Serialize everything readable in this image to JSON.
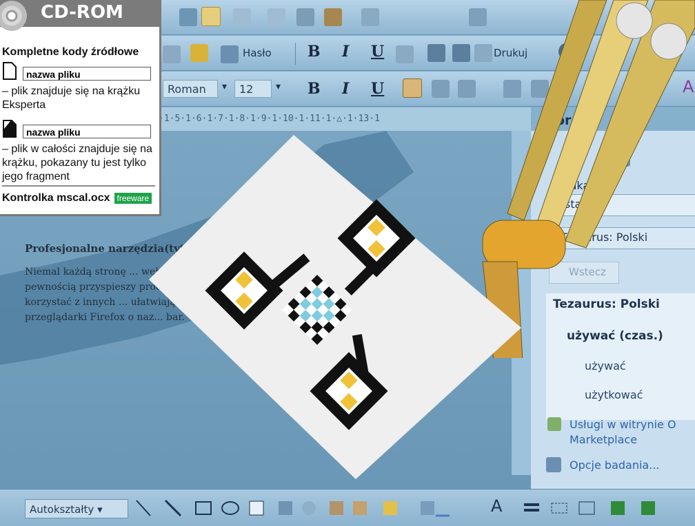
{
  "toolbar_row2": {
    "haslo_label": "Hasło",
    "bold": "B",
    "italic": "I",
    "underline": "U",
    "print_label": "Drukuj"
  },
  "toolbar_row3": {
    "font_name": "Roman",
    "font_size": "12",
    "bold": "B",
    "italic": "I",
    "underline": "U",
    "font_color_letter": "A"
  },
  "ruler": {
    "text": "·1·5·1·6·1·7·1·8·1·9·1·10·1·11·1·△·1·13·1"
  },
  "document": {
    "title": "Profesjonalne narzędzia(tyt... Xxx(lead)",
    "body": "Niemal każdą stronę ... webmaster nie powinien ... narzędzi. Skorzystanie z ba... pewnością przyspieszy proce... pozwoli na zmniejszenie liczby b... tworzenia strony korzystać z innych ... ułatwiających tworzenie strony WWW ... jest dodatek do przeglądarki Firefox o naz... bar."
  },
  "pane": {
    "header": "or",
    "search_label": "yszukaj:",
    "search_value": "zystać",
    "source_value": "Tezaurus: Polski",
    "back_label": "Wstecz",
    "tree_root": "Tezaurus: Polski",
    "tree_node": "używać (czas.)",
    "result_1": "używać",
    "result_2": "użytkować",
    "services_link": "Usługi w witrynie O Marketplace",
    "options_link": "Opcje badania..."
  },
  "drawbar": {
    "autoshapes_label": "Autokształty",
    "font_color_letter": "A"
  },
  "cdrom": {
    "title": "CD-ROM",
    "heading": "Kompletne kody źródłowe",
    "file_label_1": "nazwa pliku",
    "desc_1": "– plik znajduje się na krążku Eksperta",
    "file_label_2": "nazwa pliku",
    "desc_2": "– plik w całości znajduje się na krążku, pokazany tu jest tylko jego fragment",
    "control_name": "Kontrolka mscal.ocx",
    "license_badge": "freeware"
  },
  "colors": {
    "toolbar": "#a8c9e0",
    "pane": "#c9dff0",
    "cd_header": "#7b7b7b",
    "freeware_badge": "#1fa34a",
    "logo_yellow": "#f0c23a",
    "logo_cyan": "#7fcbe0"
  }
}
